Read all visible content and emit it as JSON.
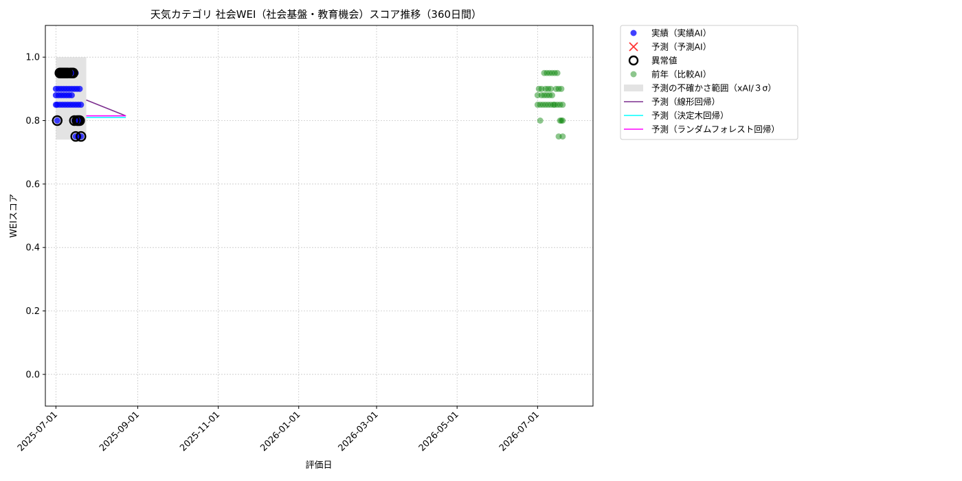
{
  "chart_data": {
    "type": "scatter",
    "title": "天気カテゴリ 社会WEI（社会基盤・教育機会）スコア推移（360日間）",
    "xlabel": "評価日",
    "ylabel": "WEIスコア",
    "xlim": [
      "2025-06-23",
      "2026-08-12"
    ],
    "ylim": [
      -0.1,
      1.1
    ],
    "x_ticks": [
      "2025-07-01",
      "2025-09-01",
      "2025-11-01",
      "2026-01-01",
      "2026-03-01",
      "2026-05-01",
      "2026-07-01"
    ],
    "y_ticks": [
      0.0,
      0.2,
      0.4,
      0.6,
      0.8,
      1.0
    ],
    "y_tick_labels": [
      "0.0",
      "0.2",
      "0.4",
      "0.6",
      "0.8",
      "1.0"
    ],
    "grid": true,
    "legend_position": "outside-top-right",
    "legend": [
      {
        "label": "実績（実績AI）",
        "kind": "dot",
        "color": "#0000ff"
      },
      {
        "label": "予測（予測AI）",
        "kind": "cross",
        "color": "#ff0000"
      },
      {
        "label": "異常値",
        "kind": "ring",
        "color": "#000000"
      },
      {
        "label": "前年（比較AI）",
        "kind": "dot-faint",
        "color": "#008000"
      },
      {
        "label": "予測の不確かさ範囲（xAI/３σ）",
        "kind": "band",
        "color": "#d9d9d9"
      },
      {
        "label": "予測（線形回帰）",
        "kind": "line",
        "color": "#7b2d8e"
      },
      {
        "label": "予測（決定木回帰）",
        "kind": "line",
        "color": "#00ffff"
      },
      {
        "label": "予測（ランダムフォレスト回帰）",
        "kind": "line",
        "color": "#ff00ff"
      }
    ],
    "series": [
      {
        "name": "実績（実績AI）",
        "color": "#0000ff",
        "points": [
          [
            "2025-07-01",
            0.85
          ],
          [
            "2025-07-01",
            0.88
          ],
          [
            "2025-07-01",
            0.9
          ],
          [
            "2025-07-02",
            0.8
          ],
          [
            "2025-07-02",
            0.85
          ],
          [
            "2025-07-03",
            0.88
          ],
          [
            "2025-07-03",
            0.9
          ],
          [
            "2025-07-04",
            0.85
          ],
          [
            "2025-07-04",
            0.95
          ],
          [
            "2025-07-05",
            0.88
          ],
          [
            "2025-07-05",
            0.9
          ],
          [
            "2025-07-06",
            0.85
          ],
          [
            "2025-07-06",
            0.95
          ],
          [
            "2025-07-07",
            0.88
          ],
          [
            "2025-07-07",
            0.9
          ],
          [
            "2025-07-08",
            0.85
          ],
          [
            "2025-07-08",
            0.95
          ],
          [
            "2025-07-09",
            0.88
          ],
          [
            "2025-07-09",
            0.9
          ],
          [
            "2025-07-10",
            0.85
          ],
          [
            "2025-07-10",
            0.95
          ],
          [
            "2025-07-11",
            0.88
          ],
          [
            "2025-07-11",
            0.9
          ],
          [
            "2025-07-12",
            0.85
          ],
          [
            "2025-07-12",
            0.95
          ],
          [
            "2025-07-13",
            0.88
          ],
          [
            "2025-07-13",
            0.9
          ],
          [
            "2025-07-14",
            0.85
          ],
          [
            "2025-07-14",
            0.95
          ],
          [
            "2025-07-15",
            0.8
          ],
          [
            "2025-07-15",
            0.9
          ],
          [
            "2025-07-16",
            0.75
          ],
          [
            "2025-07-16",
            0.85
          ],
          [
            "2025-07-16",
            0.95
          ],
          [
            "2025-07-17",
            0.8
          ],
          [
            "2025-07-17",
            0.9
          ],
          [
            "2025-07-18",
            0.75
          ],
          [
            "2025-07-18",
            0.85
          ],
          [
            "2025-07-19",
            0.8
          ],
          [
            "2025-07-19",
            0.9
          ],
          [
            "2025-07-20",
            0.75
          ],
          [
            "2025-07-20",
            0.85
          ],
          [
            "2025-07-20",
            0.8
          ]
        ]
      },
      {
        "name": "異常値",
        "color": "#000000",
        "points": [
          [
            "2025-07-02",
            0.8
          ],
          [
            "2025-07-04",
            0.95
          ],
          [
            "2025-07-05",
            0.95
          ],
          [
            "2025-07-06",
            0.95
          ],
          [
            "2025-07-07",
            0.95
          ],
          [
            "2025-07-08",
            0.95
          ],
          [
            "2025-07-09",
            0.95
          ],
          [
            "2025-07-10",
            0.95
          ],
          [
            "2025-07-12",
            0.95
          ],
          [
            "2025-07-13",
            0.95
          ],
          [
            "2025-07-14",
            0.95
          ],
          [
            "2025-07-15",
            0.8
          ],
          [
            "2025-07-16",
            0.75
          ],
          [
            "2025-07-17",
            0.8
          ],
          [
            "2025-07-18",
            0.8
          ],
          [
            "2025-07-19",
            0.8
          ],
          [
            "2025-07-20",
            0.75
          ]
        ]
      },
      {
        "name": "前年（比較AI）",
        "color": "#008000",
        "points": [
          [
            "2026-07-01",
            0.85
          ],
          [
            "2026-07-01",
            0.88
          ],
          [
            "2026-07-02",
            0.9
          ],
          [
            "2026-07-03",
            0.8
          ],
          [
            "2026-07-03",
            0.85
          ],
          [
            "2026-07-04",
            0.88
          ],
          [
            "2026-07-04",
            0.9
          ],
          [
            "2026-07-05",
            0.85
          ],
          [
            "2026-07-06",
            0.95
          ],
          [
            "2026-07-06",
            0.88
          ],
          [
            "2026-07-07",
            0.9
          ],
          [
            "2026-07-07",
            0.85
          ],
          [
            "2026-07-08",
            0.95
          ],
          [
            "2026-07-08",
            0.88
          ],
          [
            "2026-07-09",
            0.9
          ],
          [
            "2026-07-09",
            0.85
          ],
          [
            "2026-07-10",
            0.95
          ],
          [
            "2026-07-10",
            0.88
          ],
          [
            "2026-07-11",
            0.9
          ],
          [
            "2026-07-11",
            0.85
          ],
          [
            "2026-07-12",
            0.95
          ],
          [
            "2026-07-12",
            0.88
          ],
          [
            "2026-07-13",
            0.85
          ],
          [
            "2026-07-14",
            0.85
          ],
          [
            "2026-07-14",
            0.95
          ],
          [
            "2026-07-15",
            0.9
          ],
          [
            "2026-07-16",
            0.85
          ],
          [
            "2026-07-16",
            0.95
          ],
          [
            "2026-07-17",
            0.9
          ],
          [
            "2026-07-17",
            0.75
          ],
          [
            "2026-07-18",
            0.8
          ],
          [
            "2026-07-18",
            0.85
          ],
          [
            "2026-07-19",
            0.9
          ],
          [
            "2026-07-19",
            0.8
          ],
          [
            "2026-07-20",
            0.75
          ],
          [
            "2026-07-20",
            0.85
          ],
          [
            "2026-07-20",
            0.8
          ]
        ]
      }
    ],
    "uncertainty_band": {
      "x_start": "2025-07-01",
      "x_end": "2025-07-24",
      "y_low": 0.74,
      "y_high": 1.0,
      "color": "#d9d9d9"
    },
    "forecast_lines": [
      {
        "name": "予測（線形回帰）",
        "color": "#7b2d8e",
        "points": [
          [
            "2025-07-24",
            0.865
          ],
          [
            "2025-08-23",
            0.815
          ]
        ]
      },
      {
        "name": "予測（決定木回帰）",
        "color": "#00ffff",
        "points": [
          [
            "2025-07-24",
            0.81
          ],
          [
            "2025-08-23",
            0.81
          ]
        ]
      },
      {
        "name": "予測（ランダムフォレスト回帰）",
        "color": "#ff00ff",
        "points": [
          [
            "2025-07-24",
            0.815
          ],
          [
            "2025-08-23",
            0.815
          ]
        ]
      }
    ]
  }
}
